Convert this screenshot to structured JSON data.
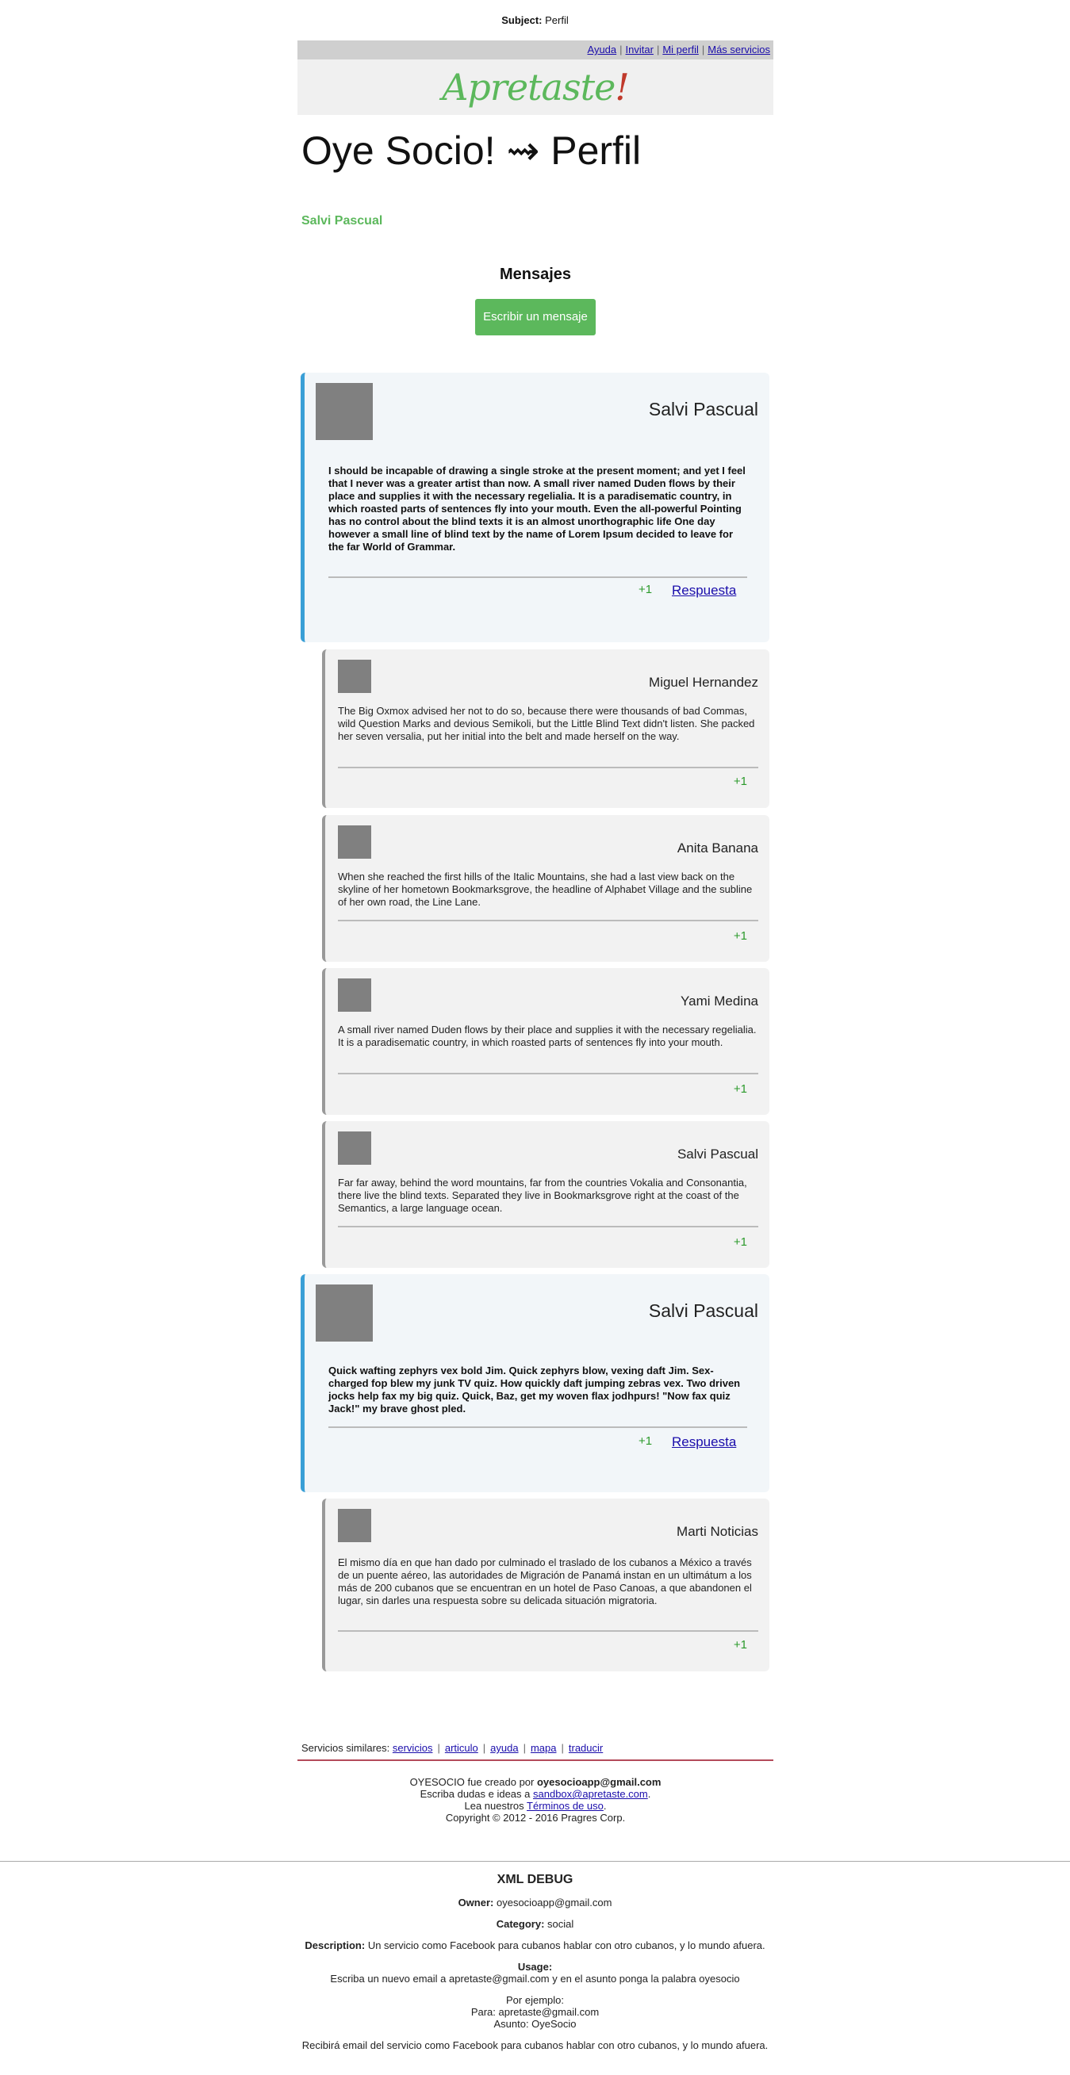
{
  "subject": {
    "label": "Subject:",
    "value": "Perfil"
  },
  "topnav": [
    "Ayuda",
    "Invitar",
    "Mi perfil",
    "Más servicios"
  ],
  "logo": {
    "main": "Apretaste",
    "mark": "!"
  },
  "page_title": "Oye Socio! ⇝ Perfil",
  "profile_name": "Salvi Pascual",
  "messages_heading": "Mensajes",
  "write_button": "Escribir un mensaje",
  "posts": [
    {
      "author": "Salvi Pascual",
      "text": "I should be incapable of drawing a single stroke at the present moment; and yet I feel that I never was a greater artist than now. A small river named Duden flows by their place and supplies it with the necessary regelialia. It is a paradisematic country, in which roasted parts of sentences fly into your mouth. Even the all-powerful Pointing has no control about the blind texts it is an almost unorthographic life One day however a small line of blind text by the name of Lorem Ipsum decided to leave for the far World of Grammar.",
      "plus": "+1",
      "reply": "Respuesta"
    },
    {
      "author": "Miguel Hernandez",
      "text": "The Big Oxmox advised her not to do so, because there were thousands of bad Commas, wild Question Marks and devious Semikoli, but the Little Blind Text didn't listen. She packed her seven versalia, put her initial into the belt and made herself on the way.",
      "plus": "+1"
    },
    {
      "author": "Anita Banana",
      "text": "When she reached the first hills of the Italic Mountains, she had a last view back on the skyline of her hometown Bookmarksgrove, the headline of Alphabet Village and the subline of her own road, the Line Lane.",
      "plus": "+1"
    },
    {
      "author": "Yami Medina",
      "text": "A small river named Duden flows by their place and supplies it with the necessary regelialia. It is a paradisematic country, in which roasted parts of sentences fly into your mouth.",
      "plus": "+1"
    },
    {
      "author": "Salvi Pascual",
      "text": "Far far away, behind the word mountains, far from the countries Vokalia and Consonantia, there live the blind texts. Separated they live in Bookmarksgrove right at the coast of the Semantics, a large language ocean.",
      "plus": "+1"
    },
    {
      "author": "Salvi Pascual",
      "text": "Quick wafting zephyrs vex bold Jim. Quick zephyrs blow, vexing daft Jim. Sex-charged fop blew my junk TV quiz. How quickly daft jumping zebras vex. Two driven jocks help fax my big quiz. Quick, Baz, get my woven flax jodhpurs! \"Now fax quiz Jack!\" my brave ghost pled.",
      "plus": "+1",
      "reply": "Respuesta"
    },
    {
      "author": "Marti Noticias",
      "text": "El mismo día en que han dado por culminado el traslado de los cubanos a México a través de un puente aéreo, las autoridades de Migración de Panamá instan en un ultimátum a los más de 200 cubanos que se encuentran en un hotel de Paso Canoas, a que abandonen el lugar, sin darles una respuesta sobre su delicada situación migratoria.",
      "plus": "+1"
    }
  ],
  "similar": {
    "label": "Servicios similares:",
    "links": [
      "servicios",
      "articulo",
      "ayuda",
      "mapa",
      "traducir"
    ]
  },
  "credits": {
    "line1_prefix": "OYESOCIO fue creado por",
    "line1_email": "oyesocioapp@gmail.com",
    "line2_prefix": "Escriba dudas e ideas a",
    "line2_email": "sandbox@apretaste.com",
    "line2_suffix": ".",
    "line3_prefix": "Lea nuestros",
    "line3_link": "Términos de uso",
    "line3_suffix": ".",
    "copyright": "Copyright © 2012 - 2016 Pragres Corp."
  },
  "debug": {
    "title": "XML DEBUG",
    "owner_label": "Owner:",
    "owner": "oyesocioapp@gmail.com",
    "category_label": "Category:",
    "category": "social",
    "description_label": "Description:",
    "description": "Un servicio como Facebook para cubanos hablar con otro cubanos, y lo mundo afuera.",
    "usage_label": "Usage:",
    "usage_text": "Escriba un nuevo email a apretaste@gmail.com y en el asunto ponga la palabra oyesocio",
    "example_label": "Por ejemplo:",
    "example_para": "Para: apretaste@gmail.com",
    "example_asunto": "Asunto: OyeSocio",
    "result": "Recibirá email del servicio como Facebook para cubanos hablar con otro cubanos, y lo mundo afuera."
  }
}
